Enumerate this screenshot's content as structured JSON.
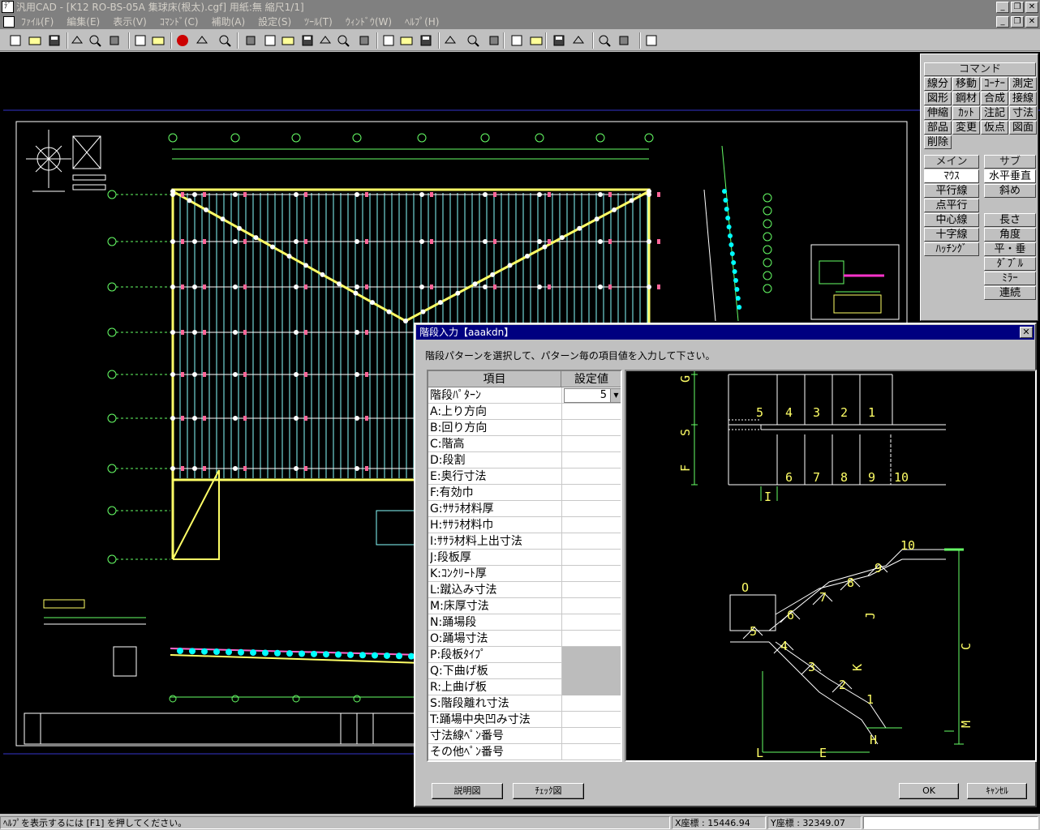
{
  "window": {
    "title": "汎用CAD - [K12 RO-BS-05A 集球床(根太).cgf]  用紙:無 縮尺1/1]",
    "app_icon": "ﾃﾞ"
  },
  "menu": [
    "ﾌｧｲﾙ(F)",
    "編集(E)",
    "表示(V)",
    "ｺﾏﾝﾄﾞ(C)",
    "補助(A)",
    "設定(S)",
    "ﾂｰﾙ(T)",
    "ｳｨﾝﾄﾞｳ(W)",
    "ﾍﾙﾌﾟ(H)"
  ],
  "toolbar_icons": [
    "new-file-icon",
    "open-folder-icon",
    "save-icon",
    "print-icon",
    "print-preview-icon",
    "plot-icon",
    "undo-icon",
    "redo-icon",
    "esc-icon",
    "select-icon",
    "move-icon",
    "rectangle-icon",
    "zoom-window-icon",
    "zoom-all-icon",
    "zoom-area-icon",
    "zoom-in-icon",
    "zoom-out-icon",
    "cursor-icon",
    "text-abc-icon",
    "text-abc2-icon",
    "trim-icon",
    "stop-icon",
    "square-icon",
    "search-icon",
    "measure-icon",
    "properties-icon",
    "copy-icon",
    "window-icon",
    "edit-icon",
    "filter-icon",
    "filter2-icon"
  ],
  "command_panel": {
    "title": "コマンド",
    "commands": [
      "線分",
      "移動",
      "ｺｰﾅｰ",
      "測定",
      "図形",
      "鋼材",
      "合成",
      "接線",
      "伸縮",
      "ｶｯﾄ",
      "注記",
      "寸法",
      "部品",
      "変更",
      "仮点",
      "図面",
      "削除"
    ],
    "main_title": "メイン",
    "sub_title": "サブ",
    "main_items": [
      "ﾏｳｽ",
      "平行線",
      "点平行",
      "中心線",
      "十字線",
      "ﾊｯﾁﾝｸﾞ"
    ],
    "sub_items": [
      "水平垂直",
      "斜め",
      "長さ",
      "角度",
      "平・垂",
      "ﾀﾞﾌﾞﾙ",
      "ﾐﾗｰ",
      "連続"
    ]
  },
  "dialog": {
    "title": "階段入力【aaakdn】",
    "instruction": "階段パターンを選択して、パターン毎の項目値を入力して下さい。",
    "col_item": "項目",
    "col_value": "設定値",
    "rows": [
      {
        "label": "階段ﾊﾟﾀｰﾝ",
        "value": "5",
        "type": "spin"
      },
      {
        "label": "A:上り方向",
        "value": ""
      },
      {
        "label": "B:回り方向",
        "value": ""
      },
      {
        "label": "C:階高",
        "value": ""
      },
      {
        "label": "D:段割",
        "value": ""
      },
      {
        "label": "E:奥行寸法",
        "value": ""
      },
      {
        "label": "F:有効巾",
        "value": ""
      },
      {
        "label": "G:ｻｻﾗ材料厚",
        "value": ""
      },
      {
        "label": "H:ｻｻﾗ材料巾",
        "value": ""
      },
      {
        "label": "I:ｻｻﾗ材料上出寸法",
        "value": ""
      },
      {
        "label": "J:段板厚",
        "value": ""
      },
      {
        "label": "K:ｺﾝｸﾘｰﾄ厚",
        "value": ""
      },
      {
        "label": "L:蹴込み寸法",
        "value": ""
      },
      {
        "label": "M:床厚寸法",
        "value": ""
      },
      {
        "label": "N:踊場段",
        "value": ""
      },
      {
        "label": "O:踊場寸法",
        "value": ""
      },
      {
        "label": "P:段板ﾀｲﾌﾟ",
        "value": "",
        "disabled": true
      },
      {
        "label": "Q:下曲げ板",
        "value": "",
        "disabled": true
      },
      {
        "label": "R:上曲げ板",
        "value": "",
        "disabled": true
      },
      {
        "label": "S:階段離れ寸法",
        "value": ""
      },
      {
        "label": "T:踊場中央凹み寸法",
        "value": ""
      },
      {
        "label": "寸法線ﾍﾟﾝ番号",
        "value": ""
      },
      {
        "label": "その他ﾍﾟﾝ番号",
        "value": ""
      }
    ],
    "preview": {
      "plan_upper_steps": [
        "5",
        "4",
        "3",
        "2",
        "1"
      ],
      "plan_lower_steps": [
        "6",
        "7",
        "8",
        "9",
        "10"
      ],
      "plan_labels": {
        "g": "G",
        "s": "S",
        "f": "F",
        "i": "I"
      },
      "section_steps": [
        "1",
        "2",
        "3",
        "4",
        "5",
        "6",
        "7",
        "8",
        "9",
        "10"
      ],
      "section_labels": {
        "o": "O",
        "j": "J",
        "k": "K",
        "c": "C",
        "m": "M",
        "l": "L",
        "e": "E",
        "h": "H"
      }
    },
    "buttons": {
      "help_diagram": "説明図",
      "check_diagram": "ﾁｪｯｸ図",
      "ok": "OK",
      "cancel": "ｷｬﾝｾﾙ"
    }
  },
  "status": {
    "help": "ﾍﾙﾌﾟを表示するには [F1] を押してください。",
    "x": "X座標 : 15446.94",
    "y": "Y座標 : 32349.07"
  },
  "colors": {
    "titlebar": "#808080",
    "dialog_title": "#000080",
    "canvas": "#000000",
    "cyan": "#00ffff",
    "yellow": "#ffff66",
    "white": "#ffffff",
    "pink": "#ff6699",
    "green": "#66ff66"
  }
}
